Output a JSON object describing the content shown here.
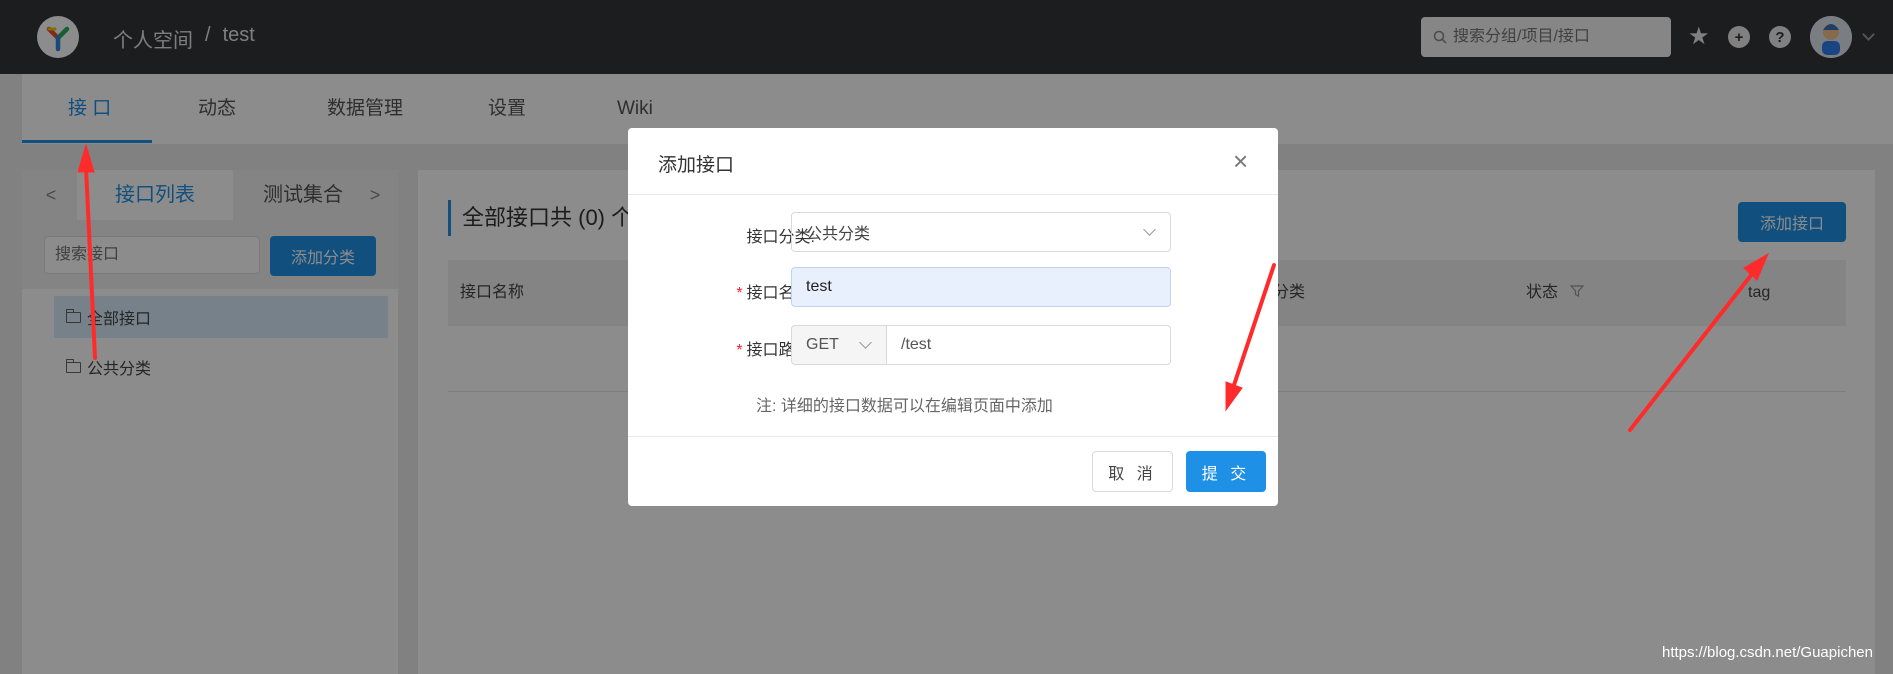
{
  "header": {
    "breadcrumb": [
      "个人空间",
      "/",
      "test"
    ],
    "search_placeholder": "搜索分组/项目/接口",
    "icons": [
      "star-icon",
      "plus-circle-icon",
      "question-circle-icon",
      "avatar",
      "caret-down-icon"
    ]
  },
  "tabs": [
    {
      "label": "接 口",
      "active": true
    },
    {
      "label": "动态"
    },
    {
      "label": "数据管理"
    },
    {
      "label": "设置"
    },
    {
      "label": "Wiki"
    }
  ],
  "left": {
    "prev": "<",
    "next": ">",
    "tab_interfaces": "接口列表",
    "tab_tests": "测试集合",
    "search_placeholder": "搜索接口",
    "add_category": "添加分类",
    "tree": [
      "全部接口",
      "公共分类"
    ]
  },
  "main": {
    "title": "全部接口共 (0) 个",
    "add_interface": "添加接口",
    "columns": [
      "接口名称",
      "接口分类",
      "状态",
      "tag"
    ]
  },
  "modal": {
    "title": "添加接口",
    "close": "×",
    "category_label": "接口分类:",
    "category_value": "公共分类",
    "name_label": "接口名称:",
    "name_value": "test",
    "path_label": "接口路径:",
    "method": "GET",
    "path_value": "/test",
    "note_label": "注:",
    "note_text": "详细的接口数据可以在编辑页面中添加",
    "cancel": "取 消",
    "submit": "提 交"
  },
  "watermark": "https://blog.csdn.net/Guapichen",
  "colors": {
    "accent": "#1e90e6",
    "header_bg": "#32363a",
    "arrow": "#ff3333",
    "required": "#f5222d"
  }
}
